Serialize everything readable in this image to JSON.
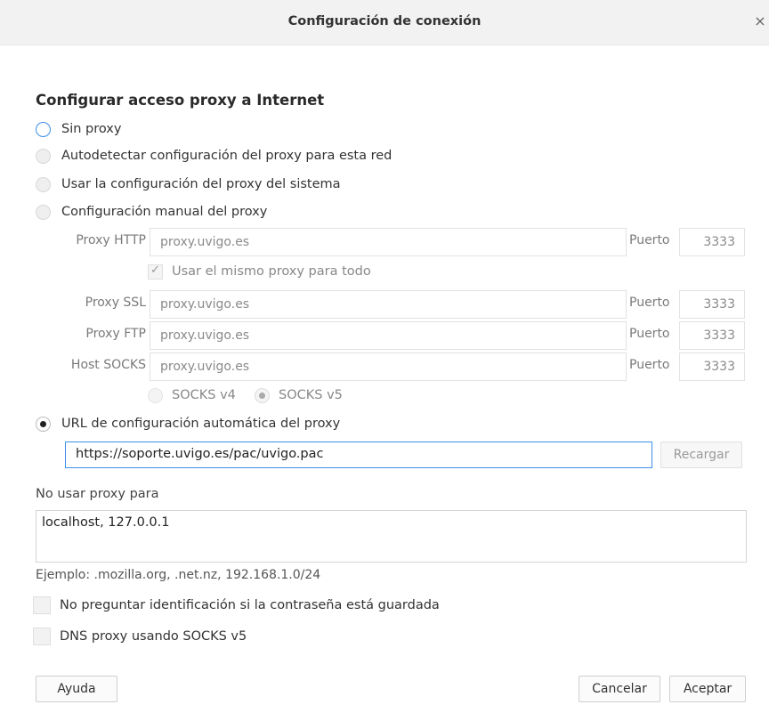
{
  "window": {
    "title": "Configuración de conexión",
    "close_glyph": "×"
  },
  "section_heading": "Configurar acceso proxy a Internet",
  "proxy_modes": [
    {
      "label": "Sin proxy",
      "state": "focused"
    },
    {
      "label": "Autodetectar configuración del proxy para esta red",
      "state": "unchecked"
    },
    {
      "label": "Usar la configuración del proxy del sistema",
      "state": "unchecked"
    },
    {
      "label": "Configuración manual del proxy",
      "state": "unchecked"
    },
    {
      "label": "URL de configuración automática del proxy",
      "state": "checked"
    }
  ],
  "manual": {
    "http": {
      "label": "Proxy HTTP",
      "host": "proxy.uvigo.es",
      "port_label": "Puerto",
      "port": "3333"
    },
    "same_proxy_label": "Usar el mismo proxy para todo",
    "ssl": {
      "label": "Proxy SSL",
      "host": "proxy.uvigo.es",
      "port_label": "Puerto",
      "port": "3333"
    },
    "ftp": {
      "label": "Proxy FTP",
      "host": "proxy.uvigo.es",
      "port_label": "Puerto",
      "port": "3333"
    },
    "socks": {
      "label": "Host SOCKS",
      "host": "proxy.uvigo.es",
      "port_label": "Puerto",
      "port": "3333"
    },
    "socks_v4_label": "SOCKS v4",
    "socks_v5_label": "SOCKS v5"
  },
  "auto_url": {
    "value": "https://soporte.uvigo.es/pac/uvigo.pac",
    "reload_label": "Recargar"
  },
  "no_proxy": {
    "label": "No usar proxy para",
    "value": "localhost, 127.0.0.1",
    "example": "Ejemplo: .mozilla.org, .net.nz, 192.168.1.0/24"
  },
  "options": {
    "no_auth_prompt_label": "No preguntar identificación si la contraseña está guardada",
    "dns_socks_label": "DNS proxy usando SOCKS v5"
  },
  "buttons": {
    "help": "Ayuda",
    "cancel": "Cancelar",
    "accept": "Aceptar"
  },
  "colors": {
    "focus_accent": "#3d8ee8",
    "titlebar_bg": "#f2f2f2"
  }
}
